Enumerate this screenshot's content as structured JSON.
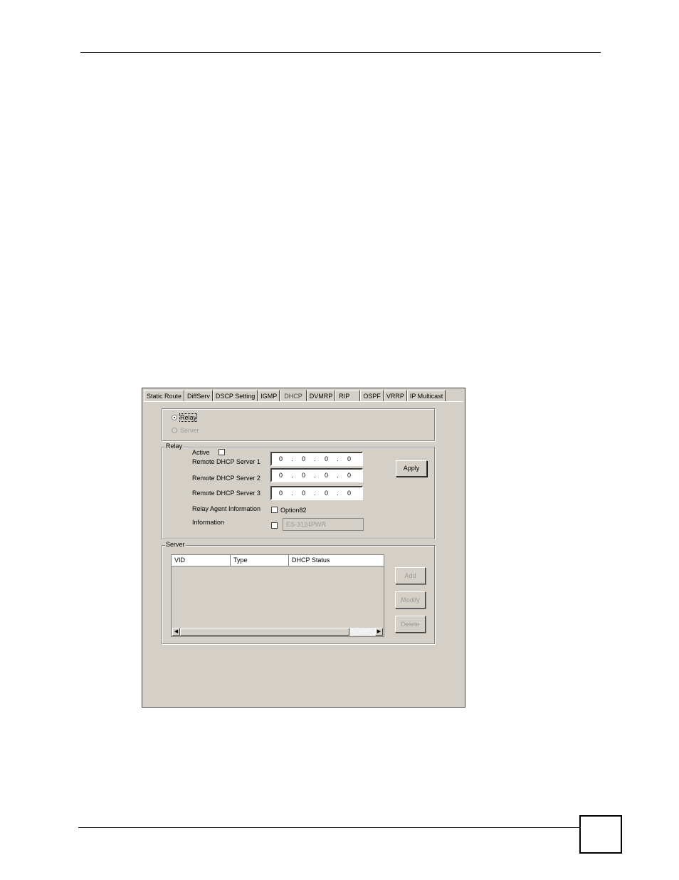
{
  "tabs": [
    "Static Route",
    "DiffServ",
    "DSCP Setting",
    "IGMP",
    "DHCP",
    "DVMRP",
    "RIP",
    "OSPF",
    "VRRP",
    "IP Multicast"
  ],
  "active_tab": "DHCP",
  "mode": {
    "relay_label": "Relay",
    "server_label": "Server",
    "selected": "Relay"
  },
  "relay": {
    "group_label": "Relay",
    "active_label": "Active",
    "servers": [
      {
        "label": "Remote DHCP Server 1",
        "octets": [
          "0",
          "0",
          "0",
          "0"
        ]
      },
      {
        "label": "Remote DHCP Server 2",
        "octets": [
          "0",
          "0",
          "0",
          "0"
        ]
      },
      {
        "label": "Remote DHCP Server 3",
        "octets": [
          "0",
          "0",
          "0",
          "0"
        ]
      }
    ],
    "agent_info_label": "Relay Agent Information",
    "option82_label": "Option82",
    "information_label": "Information",
    "information_value": "ES-3124PWR",
    "apply_label": "Apply"
  },
  "server": {
    "group_label": "Server",
    "columns": [
      "VID",
      "Type",
      "DHCP Status"
    ],
    "add_label": "Add",
    "modify_label": "Modify",
    "delete_label": "Delete"
  }
}
